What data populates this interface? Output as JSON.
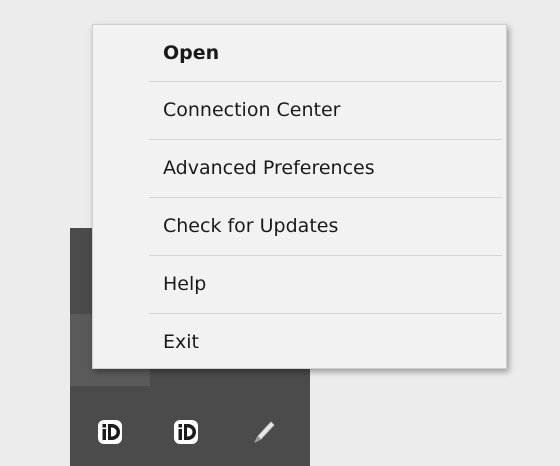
{
  "context_menu": {
    "items": [
      {
        "label": "Open",
        "bold": true
      },
      {
        "label": "Connection Center"
      },
      {
        "label": "Advanced Preferences"
      },
      {
        "label": "Check for Updates"
      },
      {
        "label": "Help"
      },
      {
        "label": "Exit"
      }
    ]
  },
  "tray": {
    "icons": [
      {
        "name": "citrix-receiver-icon"
      },
      {
        "name": "citrix-receiver-icon"
      },
      {
        "name": "pen-icon"
      }
    ]
  }
}
